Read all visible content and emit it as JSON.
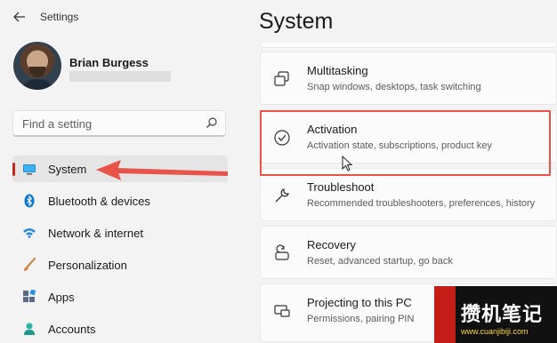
{
  "app": {
    "title": "Settings"
  },
  "user": {
    "name": "Brian Burgess"
  },
  "search": {
    "placeholder": "Find a setting"
  },
  "sidebar": {
    "items": [
      {
        "label": "System",
        "icon": "display-icon"
      },
      {
        "label": "Bluetooth & devices",
        "icon": "bluetooth-icon"
      },
      {
        "label": "Network & internet",
        "icon": "wifi-icon"
      },
      {
        "label": "Personalization",
        "icon": "brush-icon"
      },
      {
        "label": "Apps",
        "icon": "apps-icon"
      },
      {
        "label": "Accounts",
        "icon": "person-icon"
      }
    ],
    "selected": "System"
  },
  "main": {
    "title": "System",
    "cards": [
      {
        "title": "Multitasking",
        "description": "Snap windows, desktops, task switching",
        "icon": "multitasking-icon"
      },
      {
        "title": "Activation",
        "description": "Activation state, subscriptions, product key",
        "icon": "check-circle-icon"
      },
      {
        "title": "Troubleshoot",
        "description": "Recommended troubleshooters, preferences, history",
        "icon": "wrench-icon"
      },
      {
        "title": "Recovery",
        "description": "Reset, advanced startup, go back",
        "icon": "recovery-icon"
      },
      {
        "title": "Projecting to this PC",
        "description": "Permissions, pairing PIN",
        "icon": "projecting-icon"
      }
    ]
  },
  "watermark": {
    "text": "攒机笔记",
    "url": "www.cuanjibiji.com"
  },
  "colors": {
    "accent": "#0067c0",
    "selection_indicator": "#c42b1c",
    "annotation_red": "#e8534a"
  }
}
